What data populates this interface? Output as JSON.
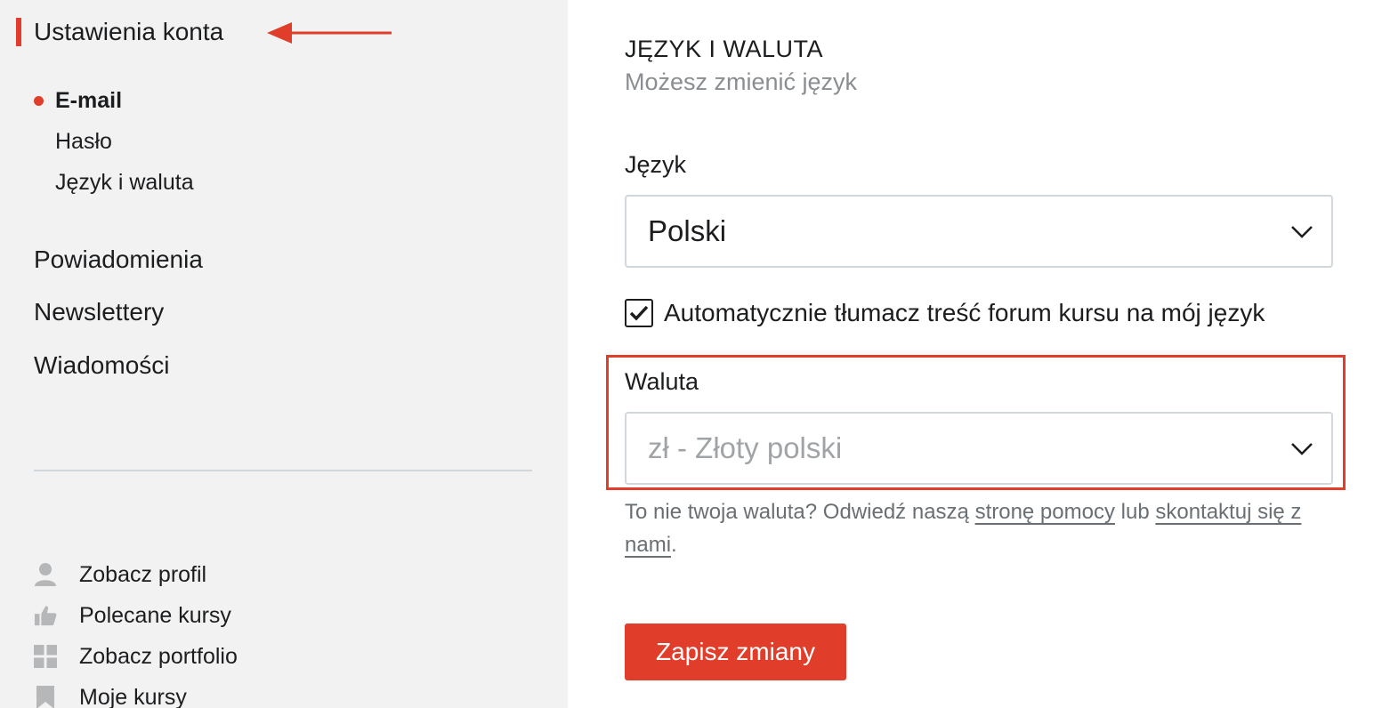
{
  "colors": {
    "accent": "#e03d2a",
    "sidebar_bg": "#f2f2f2",
    "muted_text": "#8a8d91",
    "icon_gray": "#b5b7b9"
  },
  "sidebar": {
    "section_title": "Ustawienia konta",
    "subnav": [
      {
        "label": "E-mail",
        "active": true
      },
      {
        "label": "Hasło",
        "active": false
      },
      {
        "label": "Język i waluta",
        "active": false
      }
    ],
    "mainnav": [
      {
        "label": "Powiadomienia"
      },
      {
        "label": "Newslettery"
      },
      {
        "label": "Wiadomości"
      }
    ],
    "bottomnav": [
      {
        "label": "Zobacz profil",
        "icon": "user-icon"
      },
      {
        "label": "Polecane kursy",
        "icon": "thumbs-up-icon"
      },
      {
        "label": "Zobacz portfolio",
        "icon": "grid-icon"
      },
      {
        "label": "Moje kursy",
        "icon": "bookmark-icon"
      }
    ]
  },
  "main": {
    "title": "JĘZYK I WALUTA",
    "subtitle": "Możesz zmienić język",
    "language": {
      "label": "Język",
      "value": "Polski"
    },
    "auto_translate": {
      "label": "Automatycznie tłumacz treść forum kursu na mój język",
      "checked": true
    },
    "currency": {
      "label": "Waluta",
      "value": "zł - Złoty polski"
    },
    "help": {
      "prefix": "To nie twoja waluta? Odwiedź naszą ",
      "link1": "stronę pomocy",
      "middle": " lub ",
      "link2": "skontaktuj się z nami",
      "suffix": "."
    },
    "save_label": "Zapisz zmiany"
  }
}
